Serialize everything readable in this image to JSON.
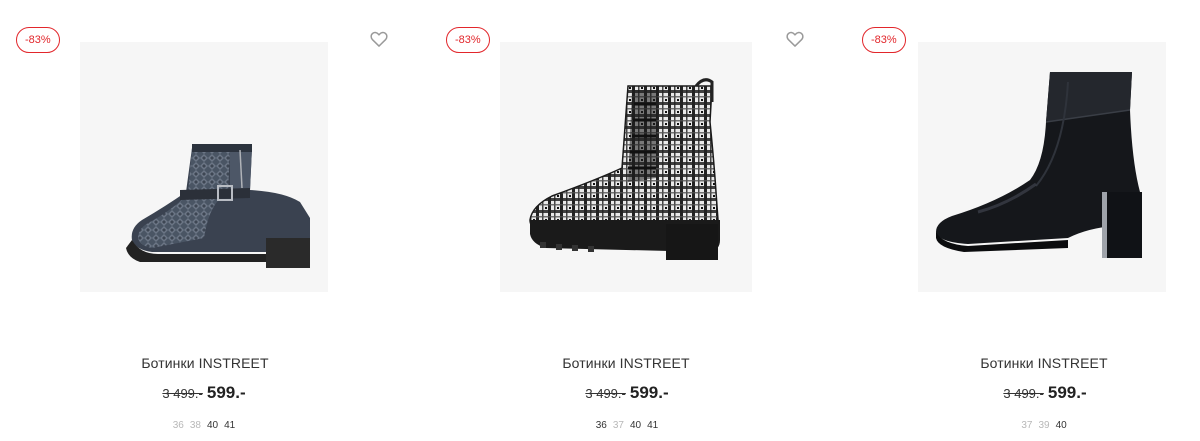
{
  "colors": {
    "accent_red": "#e2262b",
    "muted_size": "#b8b8b8",
    "text": "#333333"
  },
  "products": [
    {
      "discount": "-83%",
      "title": "Ботинки INSTREET",
      "old_price": "3 499.-",
      "price": "599.-",
      "sizes": [
        {
          "label": "36",
          "available": false
        },
        {
          "label": "38",
          "available": false
        },
        {
          "label": "40",
          "available": true
        },
        {
          "label": "41",
          "available": true
        }
      ],
      "favorite_icon": "heart-outline-icon"
    },
    {
      "discount": "-83%",
      "title": "Ботинки INSTREET",
      "old_price": "3 499.-",
      "price": "599.-",
      "sizes": [
        {
          "label": "36",
          "available": true
        },
        {
          "label": "37",
          "available": false
        },
        {
          "label": "40",
          "available": true
        },
        {
          "label": "41",
          "available": true
        }
      ],
      "favorite_icon": "heart-outline-icon"
    },
    {
      "discount": "-83%",
      "title": "Ботинки INSTREET",
      "old_price": "3 499.-",
      "price": "599.-",
      "sizes": [
        {
          "label": "37",
          "available": false
        },
        {
          "label": "39",
          "available": false
        },
        {
          "label": "40",
          "available": true
        }
      ]
    }
  ]
}
